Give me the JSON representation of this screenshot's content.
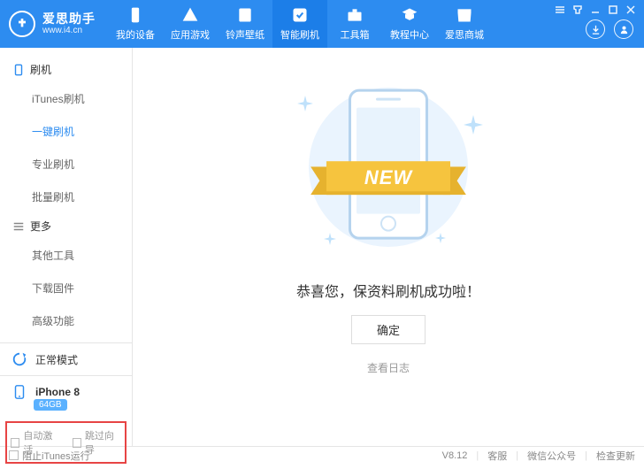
{
  "app": {
    "title": "爱思助手",
    "url": "www.i4.cn"
  },
  "nav": [
    {
      "label": "我的设备"
    },
    {
      "label": "应用游戏"
    },
    {
      "label": "铃声壁纸"
    },
    {
      "label": "智能刷机"
    },
    {
      "label": "工具箱"
    },
    {
      "label": "教程中心"
    },
    {
      "label": "爱思商城"
    }
  ],
  "sidebar": {
    "section1_title": "刷机",
    "section1_items": [
      {
        "label": "iTunes刷机"
      },
      {
        "label": "一键刷机"
      },
      {
        "label": "专业刷机"
      },
      {
        "label": "批量刷机"
      }
    ],
    "section2_title": "更多",
    "section2_items": [
      {
        "label": "其他工具"
      },
      {
        "label": "下载固件"
      },
      {
        "label": "高级功能"
      }
    ],
    "mode": "正常模式",
    "device_name": "iPhone 8",
    "device_storage": "64GB",
    "check_auto_activate": "自动激活",
    "check_skip_wizard": "跳过向导"
  },
  "main": {
    "ribbon": "NEW",
    "success": "恭喜您，保资料刷机成功啦！",
    "confirm": "确定",
    "view_log": "查看日志"
  },
  "footer": {
    "block_itunes": "阻止iTunes运行",
    "version": "V8.12",
    "support": "客服",
    "wechat": "微信公众号",
    "update": "检查更新"
  }
}
